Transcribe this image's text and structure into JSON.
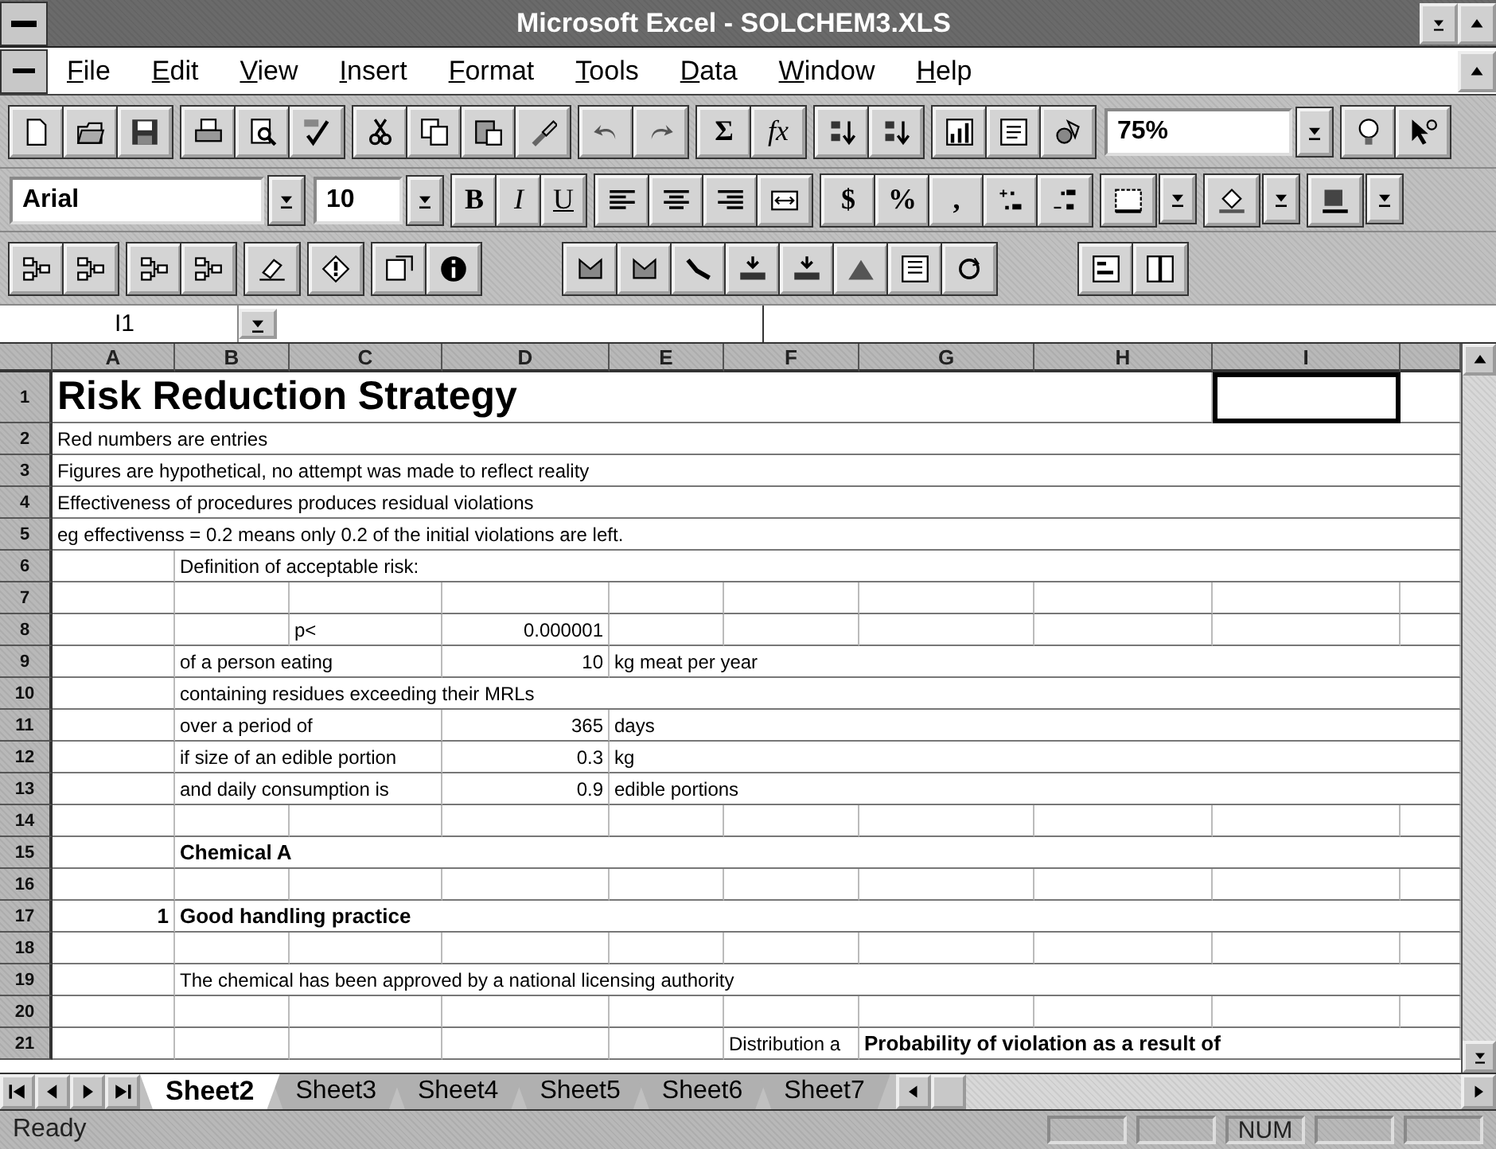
{
  "window": {
    "title": "Microsoft Excel - SOLCHEM3.XLS"
  },
  "menu": [
    {
      "label": "File"
    },
    {
      "label": "Edit"
    },
    {
      "label": "View"
    },
    {
      "label": "Insert"
    },
    {
      "label": "Format"
    },
    {
      "label": "Tools"
    },
    {
      "label": "Data"
    },
    {
      "label": "Window"
    },
    {
      "label": "Help"
    }
  ],
  "standard_toolbar": {
    "math_buttons": [
      {
        "label": "Σ",
        "kind": "sum"
      },
      {
        "label": "fx",
        "kind": "function"
      }
    ],
    "zoom": "75%"
  },
  "formatting_toolbar": {
    "font": "Arial",
    "size": "10",
    "style_buttons": [
      {
        "label": "B",
        "kind": "bold"
      },
      {
        "label": "I",
        "kind": "italic"
      },
      {
        "label": "U",
        "kind": "underline"
      }
    ],
    "number_buttons": [
      {
        "label": "$"
      },
      {
        "label": "%"
      },
      {
        "label": ","
      }
    ]
  },
  "formula_bar": {
    "name_box": "I1"
  },
  "sheet": {
    "columns": [
      "A",
      "B",
      "C",
      "D",
      "E",
      "F",
      "G",
      "H",
      "I"
    ],
    "rows": [
      {
        "number": "1",
        "cells": [
          {
            "text": "Risk Reduction Strategy",
            "kind": "title"
          },
          {
            "kind": "empty"
          },
          {
            "kind": "empty"
          },
          {
            "kind": "empty"
          },
          {
            "kind": "empty"
          },
          {
            "kind": "empty"
          },
          {
            "kind": "empty"
          },
          {
            "kind": "empty"
          },
          {
            "kind": "active"
          }
        ]
      },
      {
        "number": "2",
        "cells": [
          {
            "text": "Red numbers are entries",
            "kind": "text"
          }
        ]
      },
      {
        "number": "3",
        "cells": [
          {
            "text": "Figures are hypothetical, no attempt was made to reflect reality",
            "kind": "text"
          }
        ]
      },
      {
        "number": "4",
        "cells": [
          {
            "text": "Effectiveness of procedures produces residual violations",
            "kind": "text"
          }
        ]
      },
      {
        "number": "5",
        "cells": [
          {
            "text": "eg effectivenss = 0.2 means only 0.2 of the initial violations are left.",
            "kind": "text"
          }
        ]
      },
      {
        "number": "6",
        "cells": [
          {
            "kind": "empty"
          },
          {
            "text": "Definition of acceptable risk:",
            "kind": "text"
          }
        ]
      },
      {
        "number": "7"
      },
      {
        "number": "8",
        "cells": [
          {
            "kind": "empty"
          },
          {
            "kind": "empty"
          },
          {
            "text": "p<",
            "kind": "text"
          },
          {
            "text": "0.000001",
            "kind": "number"
          }
        ]
      },
      {
        "number": "9",
        "cells": [
          {
            "kind": "empty"
          },
          {
            "text": "of a person eating",
            "kind": "text"
          },
          {
            "kind": "empty"
          },
          {
            "text": "10",
            "kind": "number"
          },
          {
            "text": "kg meat per year",
            "kind": "text"
          }
        ]
      },
      {
        "number": "10",
        "cells": [
          {
            "kind": "empty"
          },
          {
            "text": "containing residues exceeding their MRLs",
            "kind": "text"
          }
        ]
      },
      {
        "number": "11",
        "cells": [
          {
            "kind": "empty"
          },
          {
            "text": "over a period of",
            "kind": "text"
          },
          {
            "kind": "empty"
          },
          {
            "text": "365",
            "kind": "number"
          },
          {
            "text": "days",
            "kind": "text"
          }
        ]
      },
      {
        "number": "12",
        "cells": [
          {
            "kind": "empty"
          },
          {
            "text": "if size of an edible portion",
            "kind": "text"
          },
          {
            "kind": "empty"
          },
          {
            "text": "0.3",
            "kind": "number"
          },
          {
            "text": "kg",
            "kind": "text"
          }
        ]
      },
      {
        "number": "13",
        "cells": [
          {
            "kind": "empty"
          },
          {
            "text": "and daily consumption is",
            "kind": "text"
          },
          {
            "kind": "empty"
          },
          {
            "text": "0.9",
            "kind": "number"
          },
          {
            "text": "edible portions",
            "kind": "text"
          }
        ]
      },
      {
        "number": "14"
      },
      {
        "number": "15",
        "cells": [
          {
            "kind": "empty"
          },
          {
            "text": "Chemical A",
            "kind": "bold"
          }
        ]
      },
      {
        "number": "16"
      },
      {
        "number": "17",
        "cells": [
          {
            "text": "1",
            "kind": "bold-number"
          },
          {
            "text": "Good handling practice",
            "kind": "bold"
          }
        ]
      },
      {
        "number": "18"
      },
      {
        "number": "19",
        "cells": [
          {
            "kind": "empty"
          },
          {
            "text": "The chemical has been approved by a national licensing authority",
            "kind": "text"
          }
        ]
      },
      {
        "number": "20"
      },
      {
        "number": "21",
        "cells": [
          {
            "kind": "empty"
          },
          {
            "kind": "empty"
          },
          {
            "kind": "empty"
          },
          {
            "kind": "empty"
          },
          {
            "kind": "empty"
          },
          {
            "text": "Distribution a",
            "kind": "text"
          },
          {
            "text": "Probability of violation as a result of",
            "kind": "bold"
          }
        ]
      }
    ]
  },
  "sheet_tabs": [
    {
      "label": "Sheet2",
      "selected": true
    },
    {
      "label": "Sheet3",
      "selected": false
    },
    {
      "label": "Sheet4",
      "selected": false
    },
    {
      "label": "Sheet5",
      "selected": false
    },
    {
      "label": "Sheet6",
      "selected": false
    },
    {
      "label": "Sheet7",
      "selected": false
    }
  ],
  "status_bar": {
    "text": "Ready",
    "indicator": "NUM"
  }
}
